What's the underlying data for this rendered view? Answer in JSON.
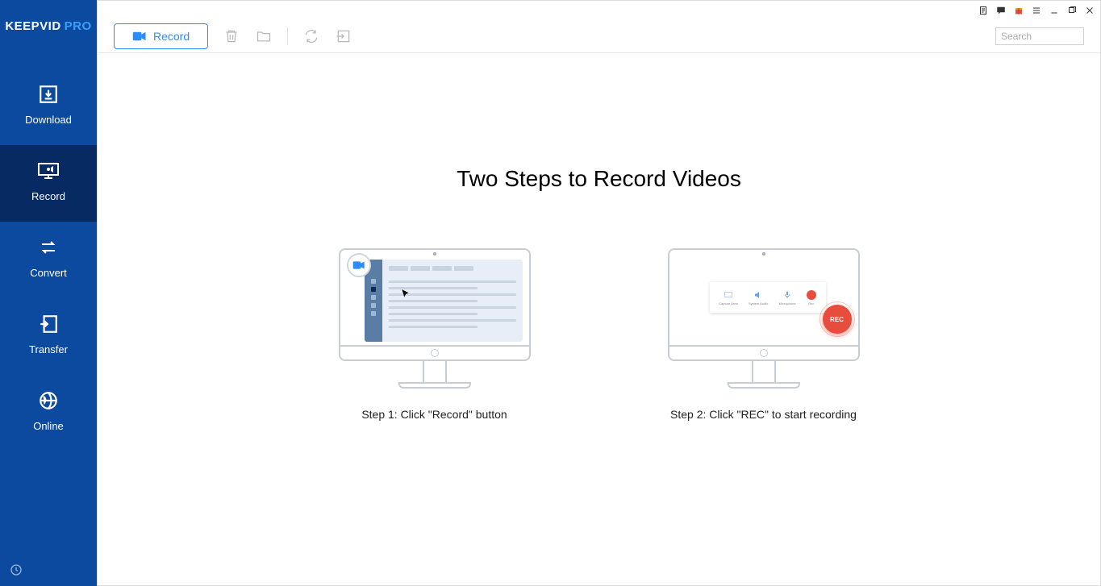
{
  "app": {
    "name": "KEEPVID",
    "suffix": "PRO"
  },
  "sidebar": {
    "items": [
      {
        "label": "Download"
      },
      {
        "label": "Record"
      },
      {
        "label": "Convert"
      },
      {
        "label": "Transfer"
      },
      {
        "label": "Online"
      }
    ]
  },
  "toolbar": {
    "record_label": "Record",
    "search_placeholder": "Search"
  },
  "content": {
    "headline": "Two Steps to Record Videos",
    "step1_caption": "Step 1: Click \"Record\" button",
    "step2_caption": "Step 2: Click \"REC\" to start recording",
    "rec_label": "REC",
    "panel_items": [
      "Capture Area",
      "System Audio",
      "Microphone",
      "Rec"
    ]
  }
}
